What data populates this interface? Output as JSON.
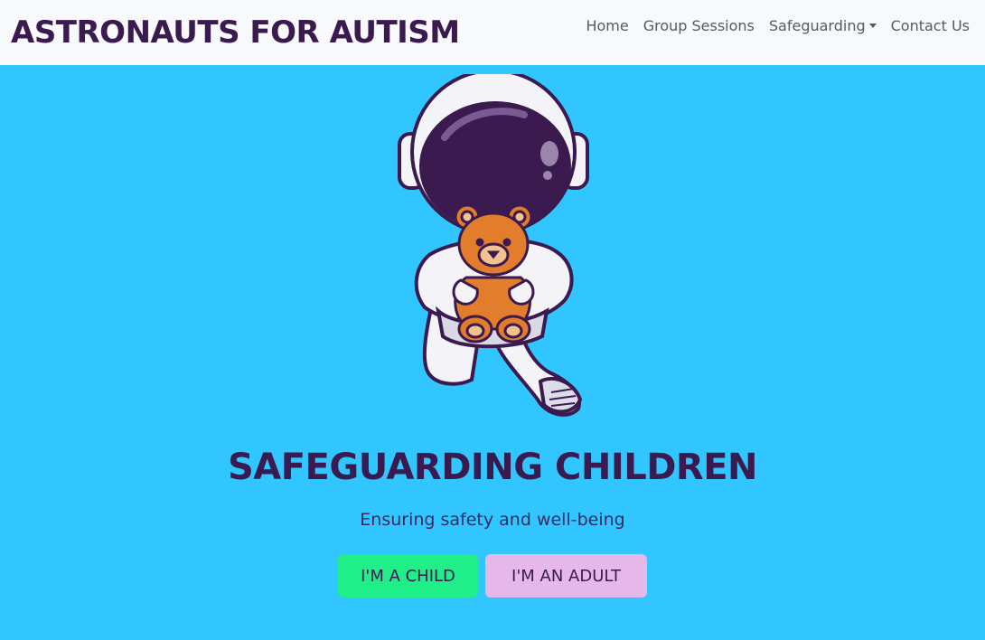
{
  "navbar": {
    "brand": "ASTRONAUTS FOR AUTISM",
    "links": {
      "home": "Home",
      "group_sessions": "Group Sessions",
      "safeguarding": "Safeguarding",
      "contact": "Contact Us"
    }
  },
  "hero": {
    "illustration": "astronaut-holding-teddy-bear",
    "title": "SAFEGUARDING CHILDREN",
    "subtitle": "Ensuring safety and well-being",
    "buttons": {
      "child": "I'M A CHILD",
      "adult": "I'M AN ADULT"
    }
  },
  "colors": {
    "background": "#31c6ff",
    "navbar_bg": "#f8f9fa",
    "brand_text": "#3a1a4f",
    "child_button": "#20ee88",
    "adult_button": "#e6b8ea"
  }
}
